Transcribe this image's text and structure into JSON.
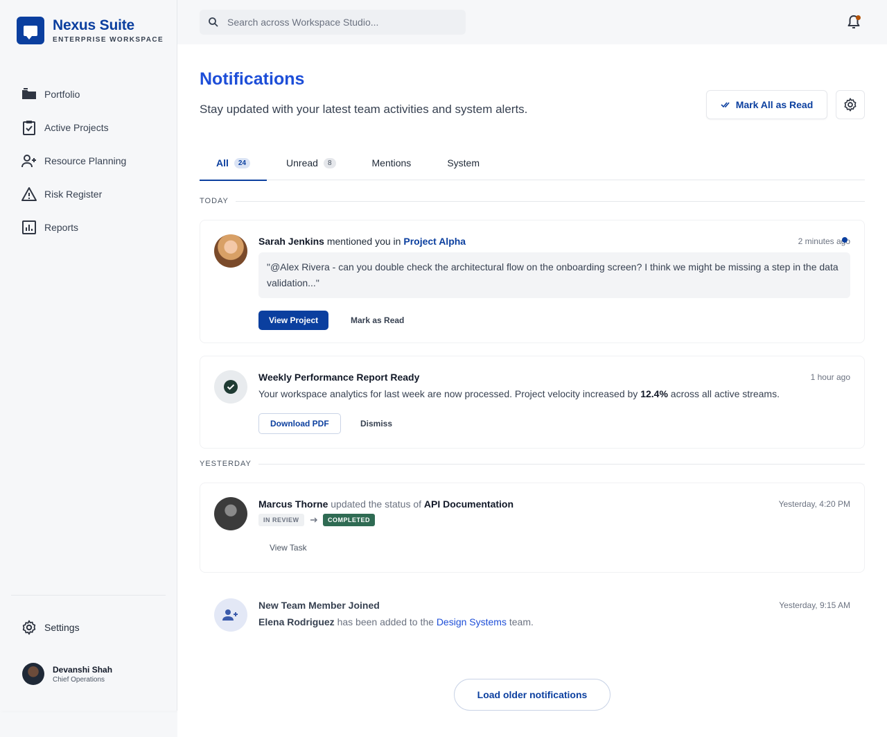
{
  "brand": {
    "name": "Nexus Suite",
    "subtitle": "ENTERPRISE WORKSPACE"
  },
  "sidebar": {
    "items": [
      {
        "label": "Portfolio",
        "icon": "folder-icon"
      },
      {
        "label": "Active Projects",
        "icon": "clipboard-check-icon"
      },
      {
        "label": "Resource Planning",
        "icon": "user-plus-icon"
      },
      {
        "label": "Risk Register",
        "icon": "warning-icon"
      },
      {
        "label": "Reports",
        "icon": "bar-chart-icon"
      }
    ],
    "settings_label": "Settings",
    "user": {
      "name": "Devanshi Shah",
      "role": "Chief Operations"
    }
  },
  "search": {
    "placeholder": "Search across Workspace Studio..."
  },
  "page": {
    "title": "Notifications",
    "subtitle": "Stay updated with your latest team activities and system alerts.",
    "mark_all_label": "Mark All as Read"
  },
  "tabs": [
    {
      "label": "All",
      "count": "24"
    },
    {
      "label": "Unread",
      "count": "8"
    },
    {
      "label": "Mentions"
    },
    {
      "label": "System"
    }
  ],
  "sections": {
    "today": "TODAY",
    "yesterday": "YESTERDAY"
  },
  "notifications": {
    "mention": {
      "actor": "Sarah Jenkins",
      "action": "mentioned you in",
      "target": "Project Alpha",
      "time": "2 minutes ago",
      "quote": "\"@Alex Rivera - can you double check the architectural flow on the onboarding screen? I think we might be missing a step in the data validation...\"",
      "primary_label": "View Project",
      "secondary_label": "Mark as Read"
    },
    "report": {
      "title": "Weekly Performance Report Ready",
      "time": "1 hour ago",
      "body_pre": "Your workspace analytics for last week are now processed. Project velocity increased by",
      "highlight": "12.4%",
      "body_post": "across all active streams.",
      "primary_label": "Download PDF",
      "secondary_label": "Dismiss"
    },
    "status": {
      "actor": "Marcus Thorne",
      "action": "updated the status of",
      "target": "API Documentation",
      "time": "Yesterday, 4:20 PM",
      "from_status": "IN REVIEW",
      "to_status": "COMPLETED",
      "link_label": "View Task"
    },
    "member": {
      "title": "New Team Member Joined",
      "time": "Yesterday, 9:15 AM",
      "person": "Elena Rodriguez",
      "body_mid": "has been added to the",
      "team": "Design Systems",
      "body_post": "team."
    }
  },
  "load_more_label": "Load older notifications",
  "colors": {
    "brand": "#0b3f9f",
    "accent": "#1d4ed8",
    "success": "#2f6b53",
    "alert": "#b45309"
  }
}
